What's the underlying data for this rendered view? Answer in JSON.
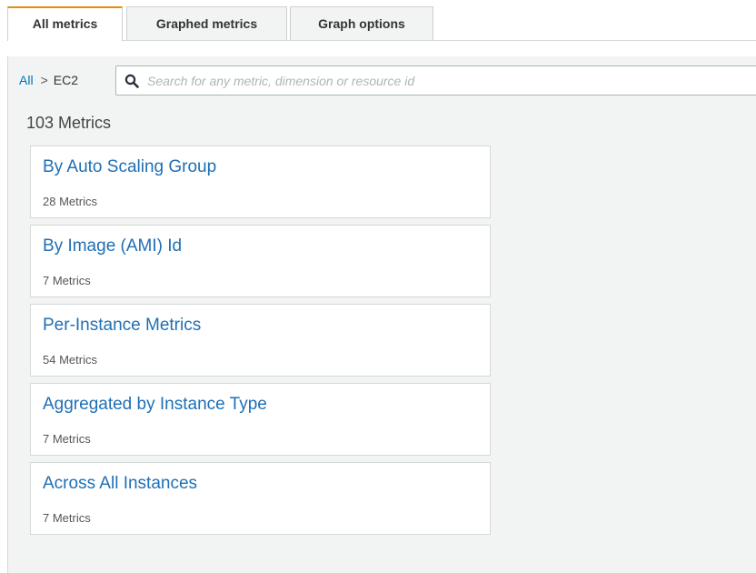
{
  "tabs": [
    {
      "label": "All metrics",
      "active": true
    },
    {
      "label": "Graphed metrics",
      "active": false
    },
    {
      "label": "Graph options",
      "active": false
    }
  ],
  "breadcrumb": {
    "root": "All",
    "separator": ">",
    "current": "EC2"
  },
  "search": {
    "placeholder": "Search for any metric, dimension or resource id",
    "value": ""
  },
  "summary": {
    "count_label": "103 Metrics"
  },
  "cards": [
    {
      "title": "By Auto Scaling Group",
      "subtitle": "28 Metrics"
    },
    {
      "title": "By Image (AMI) Id",
      "subtitle": "7 Metrics"
    },
    {
      "title": "Per-Instance Metrics",
      "subtitle": "54 Metrics"
    },
    {
      "title": "Aggregated by Instance Type",
      "subtitle": "7 Metrics"
    },
    {
      "title": "Across All Instances",
      "subtitle": "7 Metrics"
    }
  ],
  "colors": {
    "active_tab_accent": "#e88b12",
    "link": "#1f6fb5",
    "panel_bg": "#f2f3f3"
  }
}
